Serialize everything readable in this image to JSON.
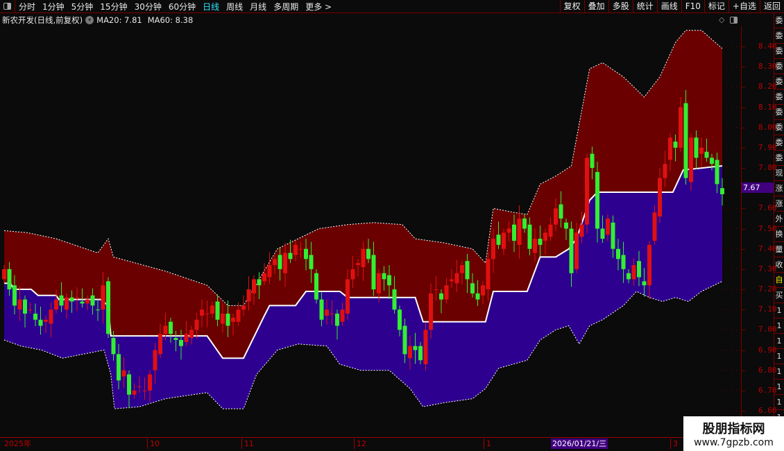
{
  "toolbar": {
    "periods": [
      "分时",
      "1分钟",
      "5分钟",
      "15分钟",
      "30分钟",
      "60分钟",
      "日线",
      "周线",
      "月线",
      "多周期",
      "更多 >"
    ],
    "active_index": 6,
    "right_buttons": [
      "复权",
      "叠加",
      "多股",
      "统计",
      "画线",
      "F10",
      "标记",
      "+自选",
      "返回"
    ]
  },
  "title": {
    "stock": "新农开发(日线,前复权)",
    "ma20": "MA20: 7.81",
    "ma60": "MA60: 8.38"
  },
  "price_axis": {
    "ticks": [
      "8.40",
      "8.30",
      "8.20",
      "8.10",
      "8.00",
      "7.90",
      "7.80",
      "7.60",
      "7.50",
      "7.40",
      "7.30",
      "7.20",
      "7.10",
      "7.00",
      "6.90",
      "6.80",
      "6.70",
      "6.60"
    ],
    "cursor_price": "7.67"
  },
  "right_strip": [
    "委",
    "委",
    "委",
    "委",
    "委",
    "委",
    "委",
    "委",
    "委",
    "委",
    "现",
    "涨",
    "涨",
    "外",
    "换",
    "量",
    "收",
    "自",
    "买",
    "1",
    "1",
    "1",
    "1",
    "1",
    "1",
    "1",
    "1"
  ],
  "time_axis": {
    "labels": [
      "2025年",
      "10",
      "11",
      "12",
      "1",
      "3"
    ],
    "cursor_date": "2026/01/21/三"
  },
  "watermark": {
    "line1": "股朋指标网",
    "line2": "www.7gpzb.com"
  },
  "colors": {
    "up": "#e01010",
    "down": "#33ee33",
    "upper_band_fill": "#6a0000",
    "lower_band_fill": "#2e0090",
    "mid_line": "#ffffff"
  },
  "chart_data": {
    "type": "candlestick",
    "ylim": [
      6.6,
      8.4
    ],
    "closes": [
      7.3,
      7.2,
      7.12,
      7.15,
      7.08,
      7.1,
      7.05,
      7.02,
      7.05,
      7.1,
      7.15,
      7.12,
      7.16,
      7.14,
      7.16,
      7.13,
      7.15,
      7.12,
      7.1,
      7.22,
      6.98,
      6.88,
      6.75,
      6.8,
      6.68,
      6.7,
      6.72,
      6.7,
      6.78,
      6.9,
      6.98,
      7.02,
      6.98,
      6.95,
      6.92,
      6.98,
      7.0,
      7.05,
      7.1,
      7.08,
      7.12,
      7.05,
      7.08,
      7.02,
      7.06,
      7.1,
      7.12,
      7.2,
      7.25,
      7.22,
      7.28,
      7.32,
      7.35,
      7.3,
      7.38,
      7.35,
      7.42,
      7.4,
      7.35,
      7.3,
      7.15,
      7.05,
      7.1,
      7.08,
      7.02,
      7.1,
      7.25,
      7.3,
      7.33,
      7.4,
      7.35,
      7.2,
      7.28,
      7.25,
      7.22,
      7.1,
      7.0,
      6.88,
      6.92,
      6.9,
      6.85,
      7.0,
      7.18,
      7.2,
      7.15,
      7.22,
      7.25,
      7.28,
      7.32,
      7.25,
      7.18,
      7.15,
      7.22,
      7.35,
      7.45,
      7.42,
      7.48,
      7.5,
      7.44,
      7.55,
      7.5,
      7.4,
      7.45,
      7.42,
      7.48,
      7.52,
      7.6,
      7.55,
      7.5,
      7.28,
      7.48,
      7.52,
      7.85,
      7.8,
      7.5,
      7.45,
      7.55,
      7.4,
      7.35,
      7.3,
      7.25,
      7.32,
      7.26,
      7.22,
      7.42,
      7.58,
      7.75,
      7.82,
      7.95,
      7.9,
      8.1,
      7.75,
      7.95,
      7.85,
      7.9,
      7.85,
      7.82,
      7.72,
      7.67
    ],
    "upper_band": [
      [
        0,
        7.49
      ],
      [
        4.5,
        7.48
      ],
      [
        10,
        7.45
      ],
      [
        18,
        7.38
      ],
      [
        20,
        7.45
      ],
      [
        21,
        7.36
      ],
      [
        31,
        7.29
      ],
      [
        39,
        7.22
      ],
      [
        43,
        7.12
      ],
      [
        46,
        7.12
      ],
      [
        52.5,
        7.4
      ],
      [
        60.5,
        7.5
      ],
      [
        66,
        7.52
      ],
      [
        71,
        7.53
      ],
      [
        76.5,
        7.52
      ],
      [
        79,
        7.45
      ],
      [
        84.5,
        7.43
      ],
      [
        90,
        7.4
      ],
      [
        92.5,
        7.33
      ],
      [
        94,
        7.6
      ],
      [
        98,
        7.58
      ],
      [
        100.5,
        7.57
      ],
      [
        103,
        7.72
      ],
      [
        106,
        7.76
      ],
      [
        109,
        7.81
      ],
      [
        112.5,
        8.29
      ],
      [
        115,
        8.32
      ],
      [
        119,
        8.25
      ],
      [
        123,
        8.15
      ],
      [
        126,
        8.25
      ],
      [
        129,
        8.42
      ],
      [
        131,
        8.48
      ],
      [
        134,
        8.48
      ],
      [
        138,
        8.39
      ]
    ],
    "mid_line": [
      [
        0,
        7.23
      ],
      [
        1.2,
        7.23
      ],
      [
        1.9,
        7.2
      ],
      [
        5.2,
        7.2
      ],
      [
        6.5,
        7.17
      ],
      [
        10,
        7.17
      ],
      [
        10.5,
        7.15
      ],
      [
        18.5,
        7.15
      ],
      [
        20,
        7.12
      ],
      [
        20.5,
        6.97
      ],
      [
        39,
        6.97
      ],
      [
        42,
        6.86
      ],
      [
        46,
        6.86
      ],
      [
        50,
        7.07
      ],
      [
        51,
        7.12
      ],
      [
        56,
        7.12
      ],
      [
        58,
        7.19
      ],
      [
        64.5,
        7.19
      ],
      [
        66,
        7.16
      ],
      [
        79,
        7.16
      ],
      [
        80.5,
        7.04
      ],
      [
        92.5,
        7.04
      ],
      [
        94,
        7.19
      ],
      [
        100.5,
        7.19
      ],
      [
        103,
        7.36
      ],
      [
        106,
        7.36
      ],
      [
        108.5,
        7.4
      ],
      [
        110,
        7.45
      ],
      [
        112.5,
        7.64
      ],
      [
        114,
        7.68
      ],
      [
        128.5,
        7.68
      ],
      [
        130.5,
        7.79
      ],
      [
        138,
        7.81
      ]
    ],
    "lower_band": [
      [
        0,
        6.95
      ],
      [
        3.2,
        6.92
      ],
      [
        7.2,
        6.9
      ],
      [
        11.2,
        6.86
      ],
      [
        19.2,
        6.9
      ],
      [
        20.5,
        6.78
      ],
      [
        21.2,
        6.61
      ],
      [
        26,
        6.62
      ],
      [
        31,
        6.66
      ],
      [
        39,
        6.69
      ],
      [
        42,
        6.61
      ],
      [
        46,
        6.61
      ],
      [
        48.5,
        6.78
      ],
      [
        52.5,
        6.9
      ],
      [
        56.5,
        6.93
      ],
      [
        62,
        6.92
      ],
      [
        64.5,
        6.83
      ],
      [
        68.5,
        6.8
      ],
      [
        74,
        6.8
      ],
      [
        78,
        6.71
      ],
      [
        80.5,
        6.62
      ],
      [
        84.5,
        6.64
      ],
      [
        90,
        6.66
      ],
      [
        92.5,
        6.71
      ],
      [
        95,
        6.81
      ],
      [
        100.5,
        6.85
      ],
      [
        103,
        6.95
      ],
      [
        106,
        7.0
      ],
      [
        108.5,
        7.02
      ],
      [
        110.5,
        6.93
      ],
      [
        112.5,
        7.02
      ],
      [
        115,
        7.05
      ],
      [
        119,
        7.12
      ],
      [
        121.5,
        7.19
      ],
      [
        124,
        7.16
      ],
      [
        126.5,
        7.14
      ],
      [
        129,
        7.16
      ],
      [
        131.5,
        7.14
      ],
      [
        134,
        7.19
      ],
      [
        138,
        7.24
      ]
    ]
  }
}
